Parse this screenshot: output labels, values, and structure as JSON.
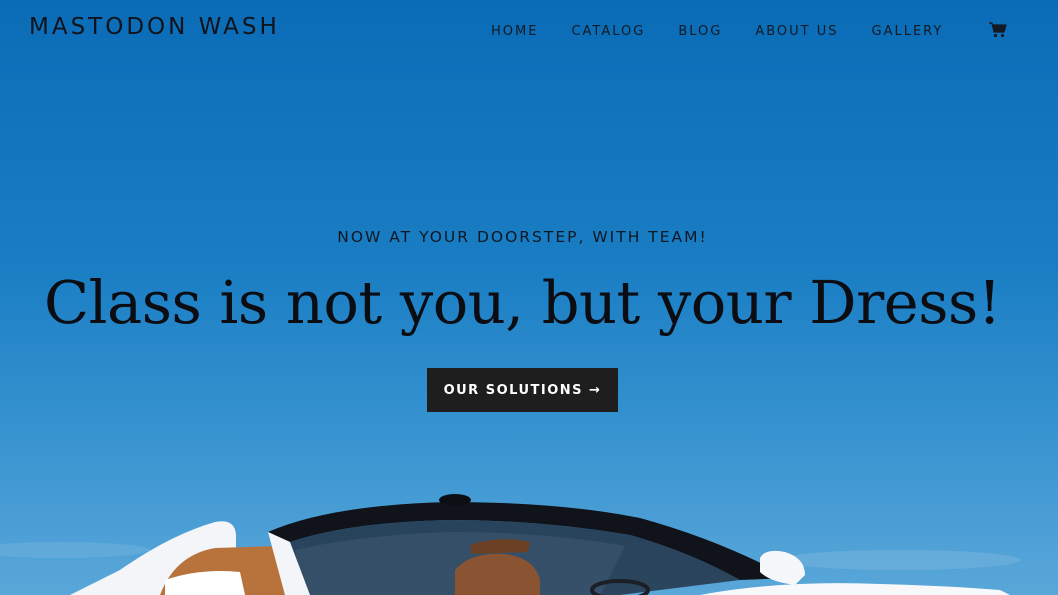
{
  "brand": {
    "name": "MASTODON WASH"
  },
  "nav": {
    "items": [
      {
        "label": "HOME"
      },
      {
        "label": "CATALOG"
      },
      {
        "label": "BLOG"
      },
      {
        "label": "ABOUT US"
      },
      {
        "label": "GALLERY"
      }
    ],
    "cart_icon": "cart-icon"
  },
  "hero": {
    "kicker": "NOW AT YOUR DOORSTEP, WITH TEAM!",
    "headline": "Class is not you, but your Dress!",
    "cta_label": "OUR SOLUTIONS",
    "cta_arrow": "→",
    "image": "white-convertible-car"
  },
  "colors": {
    "sky": "#1277c0",
    "text": "#0d1016",
    "button_bg": "#1e1e1e",
    "button_text": "#ffffff"
  }
}
